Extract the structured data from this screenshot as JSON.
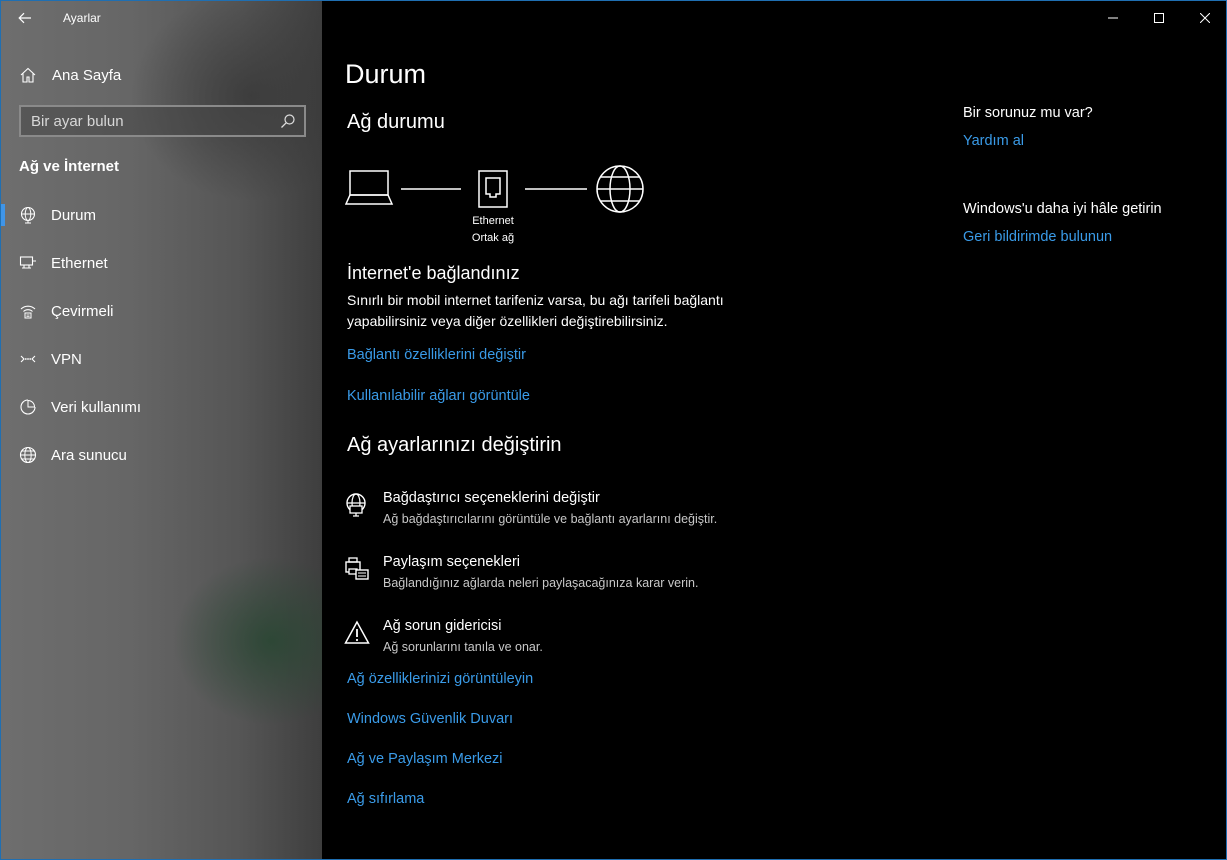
{
  "window": {
    "app_title": "Ayarlar",
    "accent": "#3a9be8"
  },
  "sidebar": {
    "home_label": "Ana Sayfa",
    "search_placeholder": "Bir ayar bulun",
    "section_title": "Ağ ve İnternet",
    "items": [
      {
        "label": "Durum",
        "icon": "globe-network-icon",
        "active": true
      },
      {
        "label": "Ethernet",
        "icon": "ethernet-icon"
      },
      {
        "label": "Çevirmeli",
        "icon": "dialup-icon"
      },
      {
        "label": "VPN",
        "icon": "vpn-icon"
      },
      {
        "label": "Veri kullanımı",
        "icon": "data-usage-icon"
      },
      {
        "label": "Ara sunucu",
        "icon": "proxy-globe-icon"
      }
    ]
  },
  "main": {
    "page_title": "Durum",
    "network_status_heading": "Ağ durumu",
    "diagram": {
      "adapter_name": "Ethernet",
      "network_type": "Ortak ağ"
    },
    "connected_title": "İnternet'e bağlandınız",
    "connected_desc": "Sınırlı bir mobil internet tarifeniz varsa, bu ağı tarifeli bağlantı yapabilirsiniz veya diğer özellikleri değiştirebilirsiniz.",
    "link_change_props": "Bağlantı özelliklerini değiştir",
    "link_view_networks": "Kullanılabilir ağları görüntüle",
    "change_settings_heading": "Ağ ayarlarınızı değiştirin",
    "settings": [
      {
        "title": "Bağdaştırıcı seçeneklerini değiştir",
        "desc": "Ağ bağdaştırıcılarını görüntüle ve bağlantı ayarlarını değiştir.",
        "icon": "adapter-globe-icon"
      },
      {
        "title": "Paylaşım seçenekleri",
        "desc": "Bağlandığınız ağlarda neleri paylaşacağınıza karar verin.",
        "icon": "sharing-printer-icon"
      },
      {
        "title": "Ağ sorun gidericisi",
        "desc": "Ağ sorunlarını tanıla ve onar.",
        "icon": "warning-icon"
      }
    ],
    "bottom_links": [
      "Ağ özelliklerinizi görüntüleyin",
      "Windows Güvenlik Duvarı",
      "Ağ ve Paylaşım Merkezi",
      "Ağ sıfırlama"
    ]
  },
  "aside": {
    "question_heading": "Bir sorunuz mu var?",
    "help_link": "Yardım al",
    "improve_heading": "Windows'u daha iyi hâle getirin",
    "feedback_link": "Geri bildirimde bulunun"
  }
}
